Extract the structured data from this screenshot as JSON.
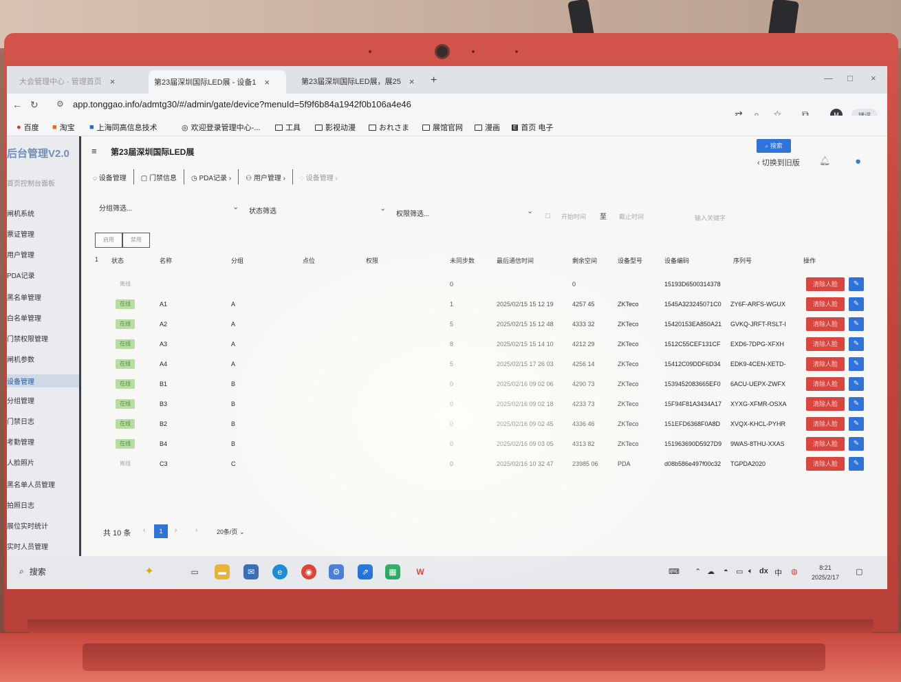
{
  "browser": {
    "tabs": [
      {
        "title": "大会管理中心 - 管理首页"
      },
      {
        "title": "第23届深圳国际LED展 - 设备1"
      },
      {
        "title": "第23届深圳国际LED展，展25"
      }
    ],
    "url": "app.tonggao.info/admtg30/#/admin/gate/device?menuId=5f9f6b84a1942f0b106a4e46",
    "bookmarks": [
      {
        "label": "百度"
      },
      {
        "label": "淘宝"
      },
      {
        "label": "上海同高信息技术"
      },
      {
        "label": "欢迎登录管理中心-..."
      },
      {
        "label": "工具"
      },
      {
        "label": "影视动漫"
      },
      {
        "label": "おれさま"
      },
      {
        "label": "展馆官网"
      },
      {
        "label": "漫画"
      },
      {
        "label": "首页 电子"
      }
    ],
    "profile_initial": "M",
    "pill_label": "错误"
  },
  "app": {
    "logo": "后台管理V2.0",
    "page_title": "第23届深圳国际LED展",
    "switch_old": "切换到旧版",
    "sidebar": [
      {
        "label": "首页控制台面板"
      },
      {
        "label": "闸机系统"
      },
      {
        "label": "票证管理"
      },
      {
        "label": "用户管理"
      },
      {
        "label": "PDA记录"
      },
      {
        "label": "黑名单管理"
      },
      {
        "label": "白名单管理"
      },
      {
        "label": "门禁权限管理"
      },
      {
        "label": "闸机参数"
      },
      {
        "label": "设备管理"
      },
      {
        "label": "分组管理"
      },
      {
        "label": "门禁日志"
      },
      {
        "label": "考勤管理"
      },
      {
        "label": "人脸照片"
      },
      {
        "label": "黑名单人员管理"
      },
      {
        "label": "拍照日志"
      },
      {
        "label": "展位实时统计"
      },
      {
        "label": "实时人员管理"
      }
    ],
    "navtabs": [
      {
        "label": "设备管理"
      },
      {
        "label": "门禁信息"
      },
      {
        "label": "PDA记录"
      },
      {
        "label": "用户管理"
      },
      {
        "label": "设备管理"
      }
    ],
    "filters": {
      "group": "分组筛选...",
      "status": "状态筛选",
      "permission": "权限筛选...",
      "start_time": "开始时间",
      "to": "至",
      "end_time": "截止时间",
      "keyword": "输入关键字",
      "search_button": "搜索"
    },
    "batch": {
      "enable": "启用",
      "disable": "禁用"
    },
    "table": {
      "headers": [
        "状态",
        "名称",
        "分组",
        "点位",
        "权限",
        "未同步数",
        "最后通信时间",
        "剩余空间",
        "设备型号",
        "设备编码",
        "序列号",
        "操作"
      ],
      "rows": [
        {
          "status": "离线",
          "name": "",
          "group": "",
          "unsynced": "0",
          "last_time": "",
          "space": "0",
          "model": "",
          "code": "15193D6500314378",
          "serial": "",
          "online": false
        },
        {
          "status": "在线",
          "name": "A1",
          "group": "A",
          "unsynced": "1",
          "last_time": "2025/02/15 15 12 19",
          "space": "4257 45",
          "model": "ZKTeco",
          "code": "1545A323245071C0",
          "serial": "ZY6F-ARFS-WGUX",
          "online": true
        },
        {
          "status": "在线",
          "name": "A2",
          "group": "A",
          "unsynced": "5",
          "last_time": "2025/02/15 15 12 48",
          "space": "4333 32",
          "model": "ZKTeco",
          "code": "15420153EA850A21",
          "serial": "GVKQ-JRFT-RSLT-I",
          "online": true
        },
        {
          "status": "在线",
          "name": "A3",
          "group": "A",
          "unsynced": "8",
          "last_time": "2025/02/15 15 14 10",
          "space": "4212 29",
          "model": "ZKTeco",
          "code": "1512C55CEF131CF",
          "serial": "EXD6-7DPG-XFXH",
          "online": true
        },
        {
          "status": "在线",
          "name": "A4",
          "group": "A",
          "unsynced": "5",
          "last_time": "2025/02/15 17 26 03",
          "space": "4256 14",
          "model": "ZKTeco",
          "code": "15412C09DDF6D34",
          "serial": "EDK9-4CEN-XETD-",
          "online": true
        },
        {
          "status": "在线",
          "name": "B1",
          "group": "B",
          "unsynced": "0",
          "last_time": "2025/02/16 09 02 06",
          "space": "4290 73",
          "model": "ZKTeco",
          "code": "1539452083665EF0",
          "serial": "6ACU-UEPX-ZWFX",
          "online": true
        },
        {
          "status": "在线",
          "name": "B3",
          "group": "B",
          "unsynced": "0",
          "last_time": "2025/02/16 09 02 18",
          "space": "4233 73",
          "model": "ZKTeco",
          "code": "15F94F81A3434A17",
          "serial": "XYXG-XFMR-OSXA",
          "online": true
        },
        {
          "status": "在线",
          "name": "B2",
          "group": "B",
          "unsynced": "0",
          "last_time": "2025/02/16 09 02 45",
          "space": "4336 46",
          "model": "ZKTeco",
          "code": "151EFD6368F0A8D",
          "serial": "XVQX-KHCL-PYHR",
          "online": true
        },
        {
          "status": "在线",
          "name": "B4",
          "group": "B",
          "unsynced": "0",
          "last_time": "2025/02/16 09 03 05",
          "space": "4313 82",
          "model": "ZKTeco",
          "code": "151963690D5927D9",
          "serial": "9WAS-8THU-XXAS",
          "online": true
        },
        {
          "status": "离线",
          "name": "C3",
          "group": "C",
          "unsynced": "0",
          "last_time": "2025/02/16 10 32 47",
          "space": "23985 06",
          "model": "PDA",
          "code": "d08b586e497f00c32",
          "serial": "TGPDA2020",
          "online": false
        }
      ],
      "action_remove": "清除人脸",
      "action_edit": "编辑"
    },
    "pager": {
      "total": "共 10 条",
      "current": "1",
      "page_size": "20条/页"
    }
  },
  "taskbar": {
    "search": "搜索",
    "tray_text": "dx",
    "time": "8:21",
    "date": "2025/2/17"
  }
}
